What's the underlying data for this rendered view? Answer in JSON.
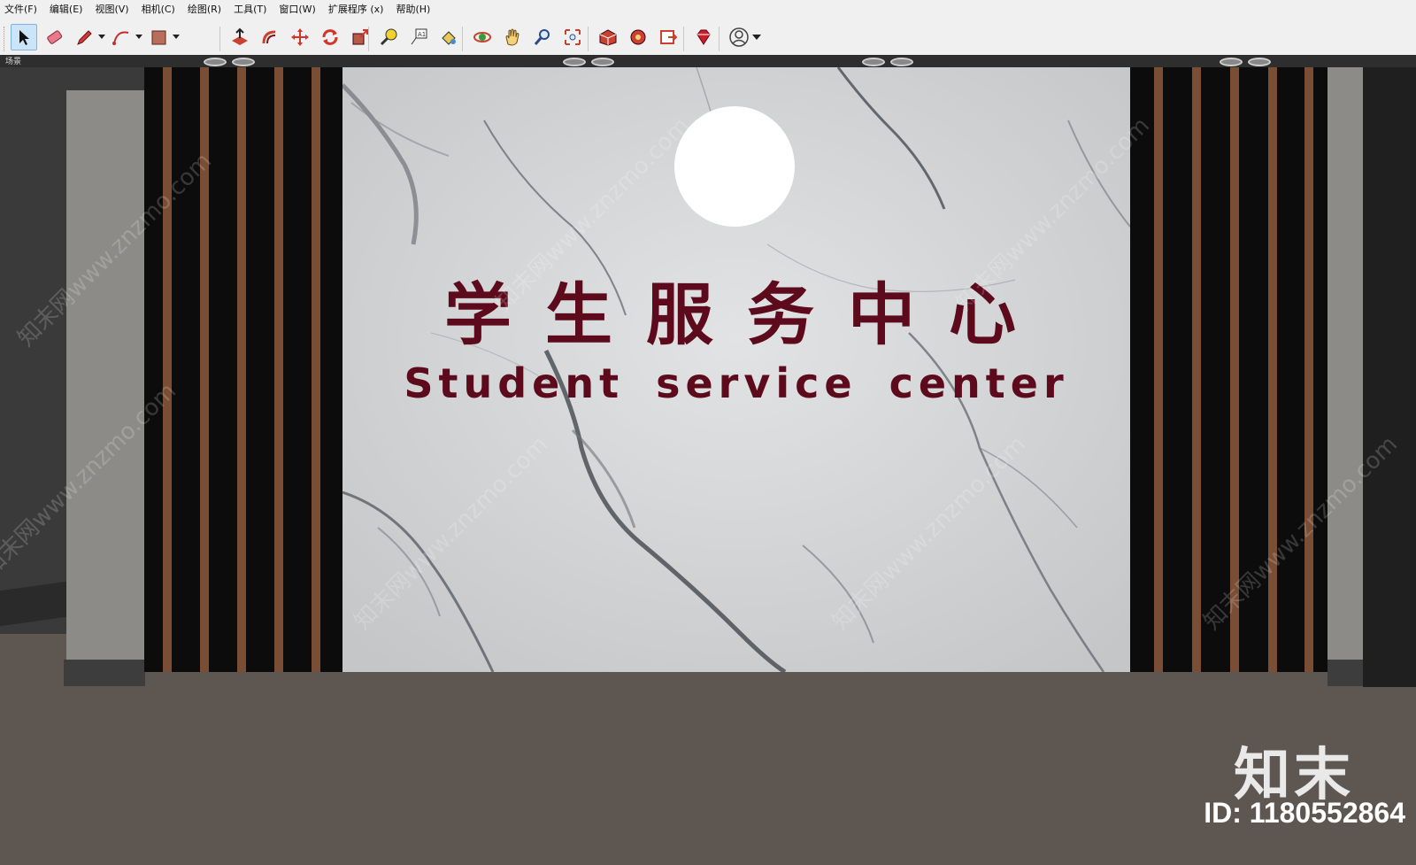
{
  "menu": [
    "文件(F)",
    "编辑(E)",
    "视图(V)",
    "相机(C)",
    "绘图(R)",
    "工具(T)",
    "窗口(W)",
    "扩展程序 (x)",
    "帮助(H)"
  ],
  "toolbar": {
    "tools": [
      {
        "name": "select",
        "icon": "arrow-cursor-icon",
        "active": true
      },
      {
        "name": "eraser",
        "icon": "eraser-icon"
      },
      {
        "name": "line",
        "icon": "pencil-icon",
        "dropdown": true
      },
      {
        "name": "arc",
        "icon": "arc-icon",
        "dropdown": true
      },
      {
        "name": "shape",
        "icon": "rectangle-icon",
        "dropdown": true
      },
      {
        "name": "push-pull",
        "icon": "push-pull-icon"
      },
      {
        "name": "offset",
        "icon": "offset-icon"
      },
      {
        "name": "move",
        "icon": "move-icon"
      },
      {
        "name": "rotate",
        "icon": "rotate-icon"
      },
      {
        "name": "scale",
        "icon": "scale-icon"
      },
      {
        "name": "tape-measure",
        "icon": "tape-measure-icon"
      },
      {
        "name": "text",
        "icon": "text-icon"
      },
      {
        "name": "paint-bucket",
        "icon": "paint-bucket-icon"
      },
      {
        "name": "orbit",
        "icon": "orbit-icon"
      },
      {
        "name": "pan",
        "icon": "pan-hand-icon"
      },
      {
        "name": "zoom",
        "icon": "zoom-icon"
      },
      {
        "name": "zoom-extents",
        "icon": "zoom-extents-icon"
      },
      {
        "name": "warehouse",
        "icon": "warehouse-icon"
      },
      {
        "name": "extension-warehouse",
        "icon": "extension-warehouse-icon"
      },
      {
        "name": "send-to-layout",
        "icon": "layout-icon"
      },
      {
        "name": "ruby-console",
        "icon": "ruby-icon"
      },
      {
        "name": "account",
        "icon": "account-icon",
        "dropdown": true
      }
    ]
  },
  "viewport": {
    "scene_label": "场景",
    "sign_zh": "学生服务中心",
    "sign_en": "Student service center",
    "watermark": "知末网www.znzmo.com",
    "logo": "知末",
    "logo_id": "ID: 1180552864"
  },
  "colors": {
    "sign_text": "#5c0a1c",
    "floor": "#5e5651",
    "slat_wood": "#7a4e35",
    "slat_black": "#0c0c0c",
    "marble": "#cfd1d2"
  }
}
